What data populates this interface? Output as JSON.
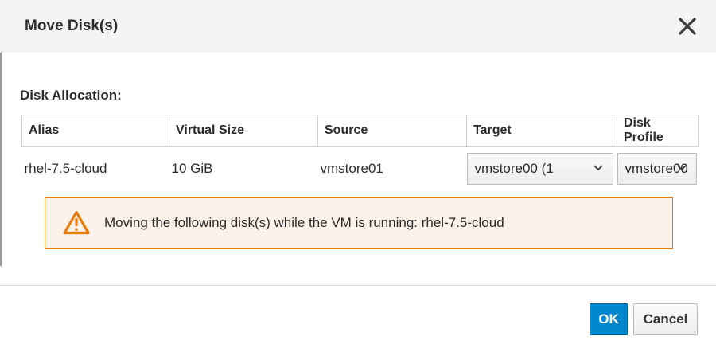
{
  "dialog": {
    "title": "Move Disk(s)",
    "close_icon": "close-icon"
  },
  "section": {
    "label": "Disk Allocation:"
  },
  "table": {
    "headers": [
      "Alias",
      "Virtual Size",
      "Source",
      "Target",
      "Disk Profile"
    ],
    "rows": [
      {
        "alias": "rhel-7.5-cloud",
        "virtual_size": "10 GiB",
        "source": "vmstore01",
        "target": "vmstore00 (1",
        "disk_profile": "vmstore00"
      }
    ]
  },
  "alert": {
    "icon": "warning-triangle-icon",
    "text": "Moving the following disk(s) while the VM is running: rhel-7.5-cloud",
    "color": "#ec7a08",
    "background": "#fdf2e9"
  },
  "buttons": {
    "ok_label": "OK",
    "cancel_label": "Cancel",
    "ok_color": "#0088ce"
  }
}
